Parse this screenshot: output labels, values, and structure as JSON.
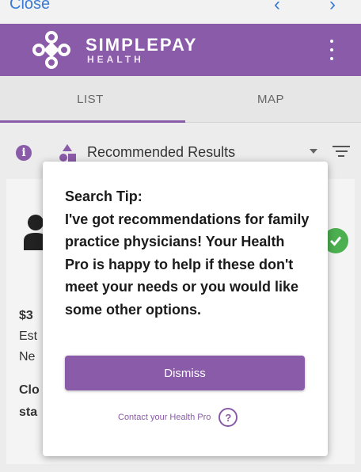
{
  "browser": {
    "close_label": "Close",
    "prev_icon": "chevron-left-icon",
    "next_icon": "chevron-right-icon"
  },
  "header": {
    "brand_name": "SIMPLEPAY",
    "brand_sub": "HEALTH",
    "accent_color": "#8a5ba8",
    "menu_icon": "more-vert-icon"
  },
  "tabs": [
    {
      "label": "LIST",
      "active": true
    },
    {
      "label": "MAP",
      "active": false
    }
  ],
  "filter": {
    "selected": "Recommended Results",
    "info_icon": "info-icon",
    "sort_icon": "sort-icon"
  },
  "background_fragments": {
    "price_frag": "$3",
    "est_frag": "Est",
    "new_frag": "Ne",
    "clo_frag": "Clo",
    "sta_frag": "sta"
  },
  "modal": {
    "tip_title": "Search Tip:",
    "tip_body": "I've got recommendations for family practice physicians! Your Health Pro is happy to help if these don't meet your needs or you would like some other options.",
    "dismiss_label": "Dismiss",
    "contact_label": "Contact your Health Pro",
    "help_glyph": "?"
  }
}
